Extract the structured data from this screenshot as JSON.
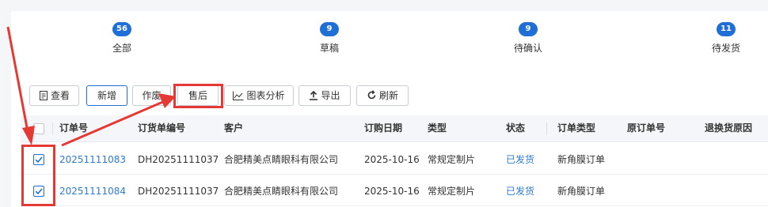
{
  "status_tabs": [
    {
      "count": "56",
      "label": "全部"
    },
    {
      "count": "9",
      "label": "草稿"
    },
    {
      "count": "9",
      "label": "待确认"
    },
    {
      "count": "11",
      "label": "待发货"
    }
  ],
  "toolbar": {
    "view": "查看",
    "add": "新增",
    "void": "作废",
    "after_sales": "售后",
    "chart": "图表分析",
    "export": "导出",
    "refresh": "刷新"
  },
  "table": {
    "columns": [
      "订单号",
      "订货单编号",
      "客户",
      "订购日期",
      "类型",
      "状态",
      "订单类型",
      "原订单号",
      "退换货原因"
    ],
    "rows": [
      {
        "order_no": "20251111083",
        "purchase_no": "DH20251111037",
        "customer": "合肥精美点睛眼科有限公司",
        "date": "2025-10-16",
        "type": "常规定制片",
        "status": "已发货",
        "order_type": "新角膜订单",
        "orig_no": "",
        "reason": "",
        "checked": true
      },
      {
        "order_no": "20251111084",
        "purchase_no": "DH20251111037",
        "customer": "合肥精美点睛眼科有限公司",
        "date": "2025-10-16",
        "type": "常规定制片",
        "status": "已发货",
        "order_type": "新角膜订单",
        "orig_no": "",
        "reason": "",
        "checked": true
      }
    ]
  },
  "colors": {
    "accent": "#1f6fd6",
    "link": "#2f7ad1",
    "annotation": "#e53935"
  },
  "icons": {
    "view": "document-icon",
    "chart": "line-chart-icon",
    "export": "upload-icon",
    "refresh": "refresh-icon",
    "checkbox": "check-icon"
  }
}
